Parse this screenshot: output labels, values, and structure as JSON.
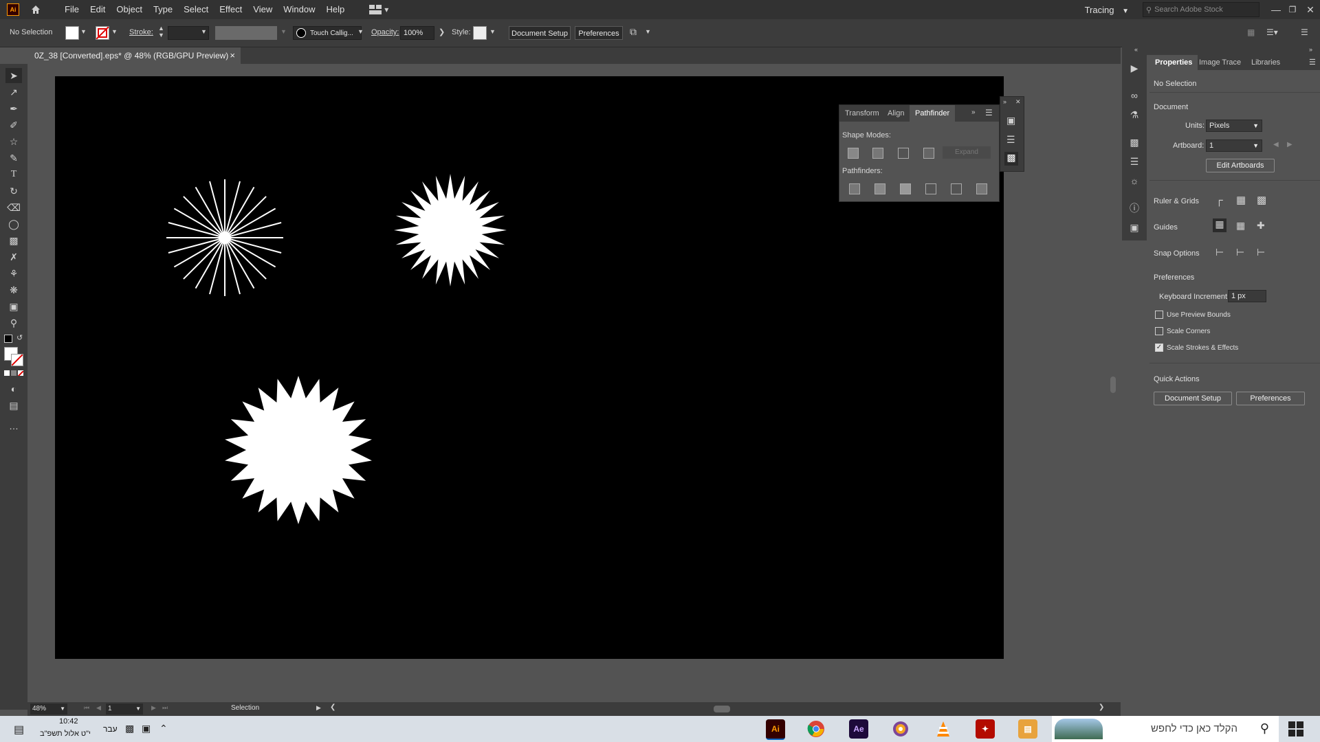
{
  "app": {
    "logo": "Ai",
    "menus": [
      "File",
      "Edit",
      "Object",
      "Type",
      "Select",
      "Effect",
      "View",
      "Window",
      "Help"
    ],
    "workspace": "Tracing",
    "search_placeholder": "Search Adobe Stock"
  },
  "control_bar": {
    "selection": "No Selection",
    "stroke_label": "Stroke:",
    "brush_name": "Touch Callig...",
    "opacity_label": "Opacity:",
    "opacity_value": "100%",
    "style_label": "Style:",
    "document_setup": "Document Setup",
    "preferences": "Preferences"
  },
  "document": {
    "tab_title": "0Z_38 [Converted].eps* @ 48% (RGB/GPU Preview)",
    "close_symbol": "×"
  },
  "pathfinder_panel": {
    "tabs": [
      "Transform",
      "Align",
      "Pathfinder"
    ],
    "active_tab": "Pathfinder",
    "shape_modes_label": "Shape Modes:",
    "expand_label": "Expand",
    "pathfinders_label": "Pathfinders:"
  },
  "properties_panel": {
    "tabs": [
      "Properties",
      "Image Trace",
      "Libraries"
    ],
    "selection": "No Selection",
    "document_section": "Document",
    "units_label": "Units:",
    "units_value": "Pixels",
    "artboard_label": "Artboard:",
    "artboard_value": "1",
    "edit_artboards": "Edit Artboards",
    "ruler_grids": "Ruler & Grids",
    "guides": "Guides",
    "snap_options": "Snap Options",
    "preferences_section": "Preferences",
    "keyboard_increment_label": "Keyboard Increment:",
    "keyboard_increment_value": "1 px",
    "checkboxes": [
      {
        "label": "Use Preview Bounds",
        "checked": false
      },
      {
        "label": "Scale Corners",
        "checked": false
      },
      {
        "label": "Scale Strokes & Effects",
        "checked": true
      }
    ],
    "quick_actions": "Quick Actions",
    "qa_document_setup": "Document Setup",
    "qa_preferences": "Preferences"
  },
  "status_bar": {
    "zoom": "48%",
    "artboard_number": "1",
    "current_tool": "Selection"
  },
  "taskbar": {
    "time": "10:42",
    "date": "י\"ט אלול תשפ\"ב",
    "language": "עבר",
    "search_placeholder": "הקלד כאן כדי לחפש",
    "apps": [
      "Ai",
      "Chrome",
      "Ae",
      "Tor",
      "VLC",
      "Acrobat",
      "Files"
    ]
  },
  "colors": {
    "fill": "#ffffff",
    "stroke": "none",
    "accent": "#ff9a00"
  }
}
